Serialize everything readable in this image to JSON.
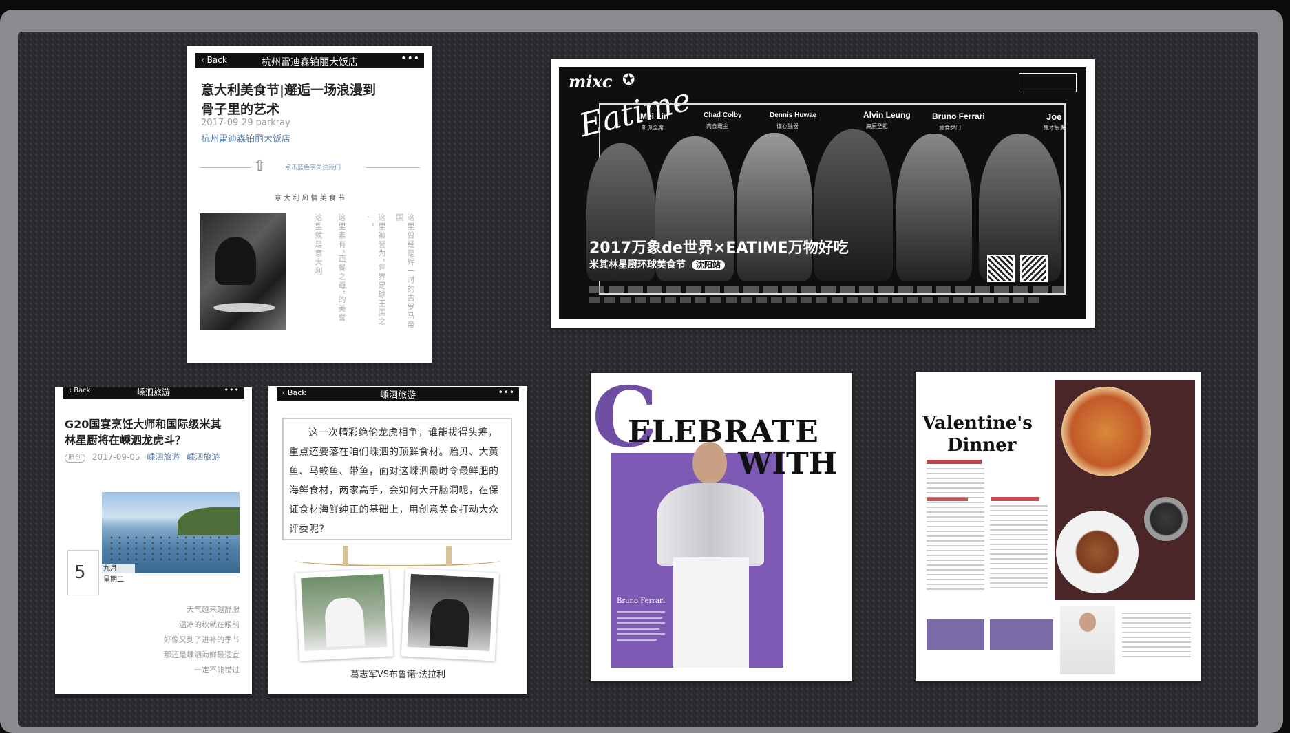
{
  "card1": {
    "back": "Back",
    "bar_title": "杭州雷迪森铂丽大饭店",
    "dots": "•••",
    "title_line1": "意大利美食节|邂逅一场浪漫到",
    "title_line2": "骨子里的艺术",
    "date_author": "2017-09-29  parkray",
    "account": "杭州雷迪森铂丽大饭店",
    "tag": "点击蓝色字关注我们",
    "section": "意 大 利 风 情 美 食 节",
    "vertical": [
      "这里曾经是辉一时的古罗马帝国",
      "这里被誉为“世界足球王国之一”",
      "这里素有“西餐之母”的美誉",
      "这里就是意大利"
    ]
  },
  "poster": {
    "brand": "mixc",
    "script_title": "Eatime",
    "chefs": [
      {
        "name": "Mei Lin",
        "sub": "新派全席"
      },
      {
        "name": "Chad Colby",
        "sub": "肉食霸主"
      },
      {
        "name": "Dennis Huwae",
        "sub": "谨心独器"
      },
      {
        "name": "Alvin Leung",
        "sub": "魔厨圣祖"
      },
      {
        "name": "Bruno Ferrari",
        "sub": "意食罗门"
      },
      {
        "name": "Joe",
        "sub": "鬼才厨魔"
      }
    ],
    "headline": "2017万象de世界×EATIME万物好吃",
    "subline": "米其林星厨环球美食节",
    "badge": "沈阳站"
  },
  "card3": {
    "back": "Back",
    "bar_title": "嵊泗旅游",
    "dots": "•••",
    "title_line1": "G20国宴烹饪大师和国际级米其",
    "title_line2": "林星厨将在嵊泗龙虎斗？",
    "original": "原创",
    "date": "2017-09-05",
    "account1": "嵊泗旅游",
    "account2": "嵊泗旅游",
    "day": "5",
    "month": "九月",
    "weekday": "星期二",
    "poem": [
      "天气越来越舒服",
      "温凉的秋就在眼前",
      "好像又到了进补的季节",
      "那还是嵊泗海鲜最适宜",
      "一定不能错过"
    ]
  },
  "card4": {
    "back": "Back",
    "bar_title": "嵊泗旅游",
    "dots": "•••",
    "body": "这一次精彩绝伦龙虎相争，谁能拔得头筹，重点还要落在咱们嵊泗的顶鲜食材。贻贝、大黄鱼、马鲛鱼、带鱼，面对这嵊泗最时令最鲜肥的海鲜食材，两家高手，会如何大开脑洞呢，在保证食材海鲜纯正的基础上，用创意美食打动大众评委呢?",
    "caption": "葛志军VS布鲁诺·法拉利"
  },
  "card5": {
    "big": "C",
    "word1": "ELEBRATE",
    "word2": "WITH",
    "name": "Bruno Ferrari"
  },
  "card6": {
    "title_line1": "Valentine's",
    "title_line2": "Dinner"
  },
  "colors": {
    "purple": "#6f4ea3",
    "board": "#2a2b2e"
  }
}
